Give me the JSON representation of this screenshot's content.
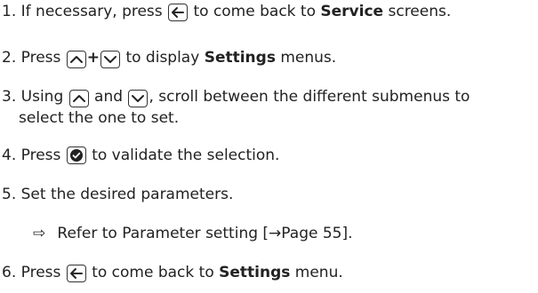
{
  "steps": [
    {
      "num": "1.",
      "t1": "If necessary, press",
      "t2": "to come back to",
      "bold": "Service",
      "t3": "screens."
    },
    {
      "num": "2.",
      "t1": "Press",
      "plus": "+",
      "t2": "to display",
      "bold": "Settings",
      "t3": "menus."
    },
    {
      "num": "3.",
      "t1": "Using",
      "t2": "and",
      "t3": ", scroll between the different submenus to",
      "t4": "select the one to set."
    },
    {
      "num": "4.",
      "t1": "Press",
      "t2": "to validate the selection."
    },
    {
      "num": "5.",
      "t1": "Set the desired parameters."
    },
    {
      "num": "6.",
      "t1": "Press",
      "t2": "to come back to",
      "bold": "Settings",
      "t3": "menu."
    }
  ],
  "note": {
    "bullet": "⇨",
    "text": "Refer to Parameter setting [→Page 55]."
  },
  "icons": {
    "back": "back-arrow-icon",
    "up": "chevron-up-icon",
    "down": "chevron-down-icon",
    "ok": "check-circle-icon"
  }
}
